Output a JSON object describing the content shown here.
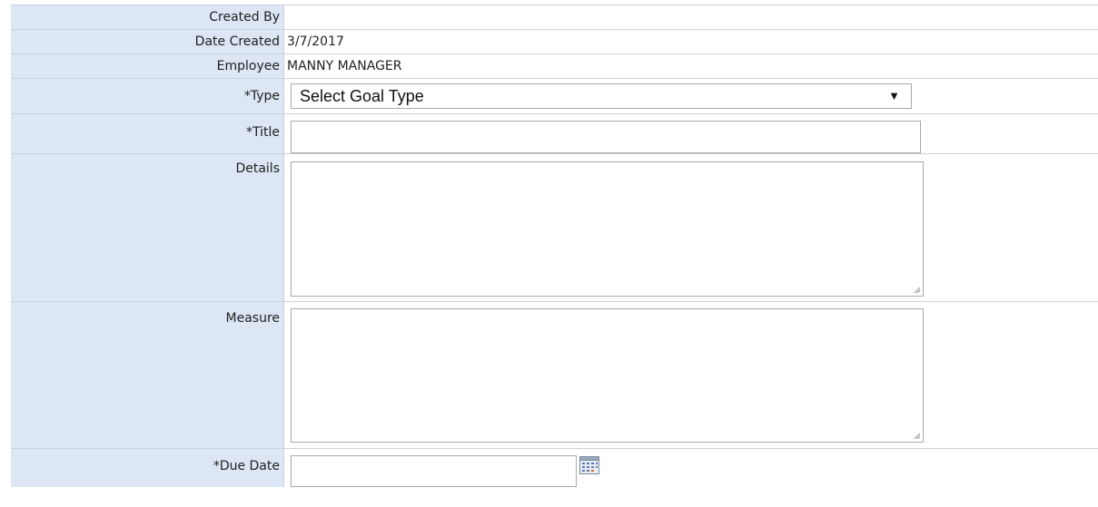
{
  "form": {
    "created_by": {
      "label": "Created By",
      "value": ""
    },
    "date_created": {
      "label": "Date Created",
      "value": "3/7/2017"
    },
    "employee": {
      "label": "Employee",
      "value": "MANNY MANAGER"
    },
    "type": {
      "label": "*Type",
      "selected": "Select Goal Type",
      "arrow": "▼"
    },
    "title": {
      "label": "*Title",
      "value": ""
    },
    "details": {
      "label": "Details",
      "value": ""
    },
    "measure": {
      "label": "Measure",
      "value": ""
    },
    "due_date": {
      "label": "*Due Date",
      "value": "",
      "icon": "calendar-icon"
    }
  }
}
